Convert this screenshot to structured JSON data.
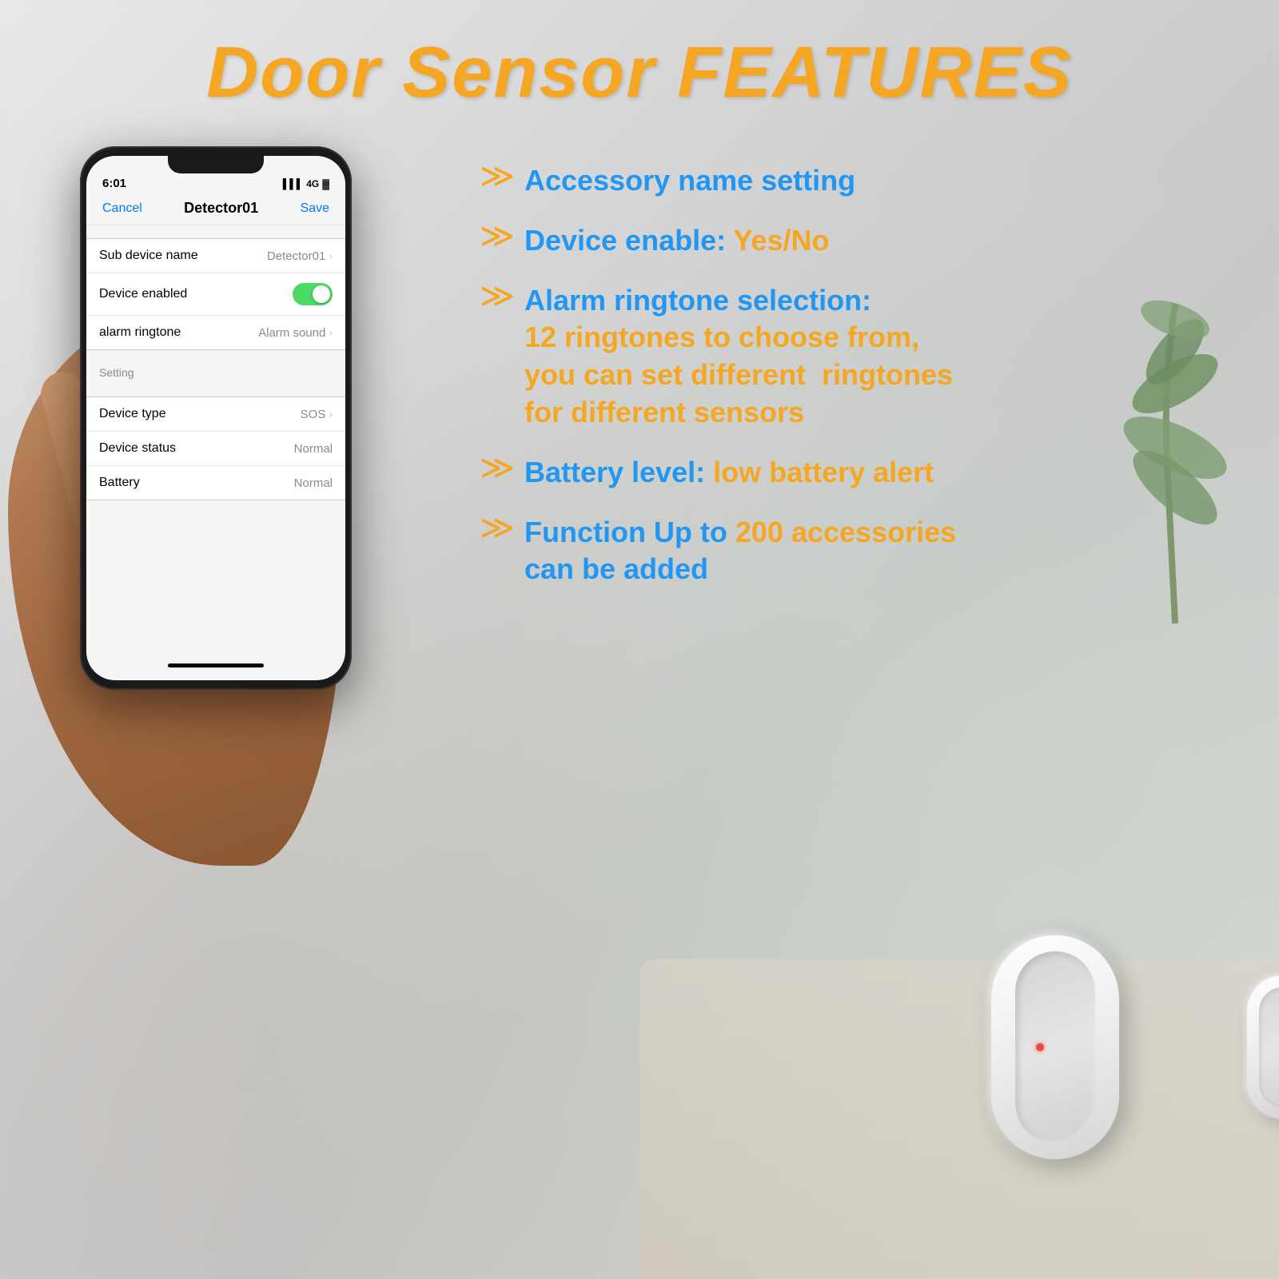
{
  "title": "Door Sensor FEATURES",
  "phone": {
    "time": "6:01",
    "signal": "4G",
    "nav_cancel": "Cancel",
    "nav_title": "Detector01",
    "nav_save": "Save",
    "rows": [
      {
        "label": "Sub device name",
        "value": "Detector01",
        "hasChevron": true,
        "type": "nav"
      },
      {
        "label": "Device enabled",
        "value": "",
        "type": "toggle"
      },
      {
        "label": "alarm ringtone",
        "value": "Alarm sound",
        "hasChevron": true,
        "type": "nav"
      }
    ],
    "section_label": "Setting",
    "setting_rows": [
      {
        "label": "Device type",
        "value": "SOS",
        "hasChevron": true,
        "type": "nav"
      },
      {
        "label": "Device status",
        "value": "Normal",
        "hasChevron": false,
        "type": "value"
      },
      {
        "label": "Battery",
        "value": "Normal",
        "hasChevron": false,
        "type": "value"
      }
    ]
  },
  "features": [
    {
      "text": "Accessory name setting",
      "orange_parts": []
    },
    {
      "text": "Device enable: Yes/No",
      "orange_parts": [
        "Yes/No"
      ]
    },
    {
      "text": "Alarm ringtone selection: 12 ringtones to choose from, you can set different  ringtones for different sensors",
      "orange_parts": [
        "12 ringtones to choose from,",
        "you can set different  ringtones",
        "for different sensors"
      ]
    },
    {
      "text_blue": "Battery level: ",
      "text_orange": "low battery alert",
      "combined": true
    },
    {
      "text_blue": "Function Up to 200 accessories can be added",
      "text_orange": "",
      "combined": false,
      "orange_inline": "200 accessories"
    }
  ],
  "feature_arrow": "≫",
  "colors": {
    "orange": "#f5a623",
    "blue": "#2196f3",
    "title_orange": "#f5a623"
  }
}
